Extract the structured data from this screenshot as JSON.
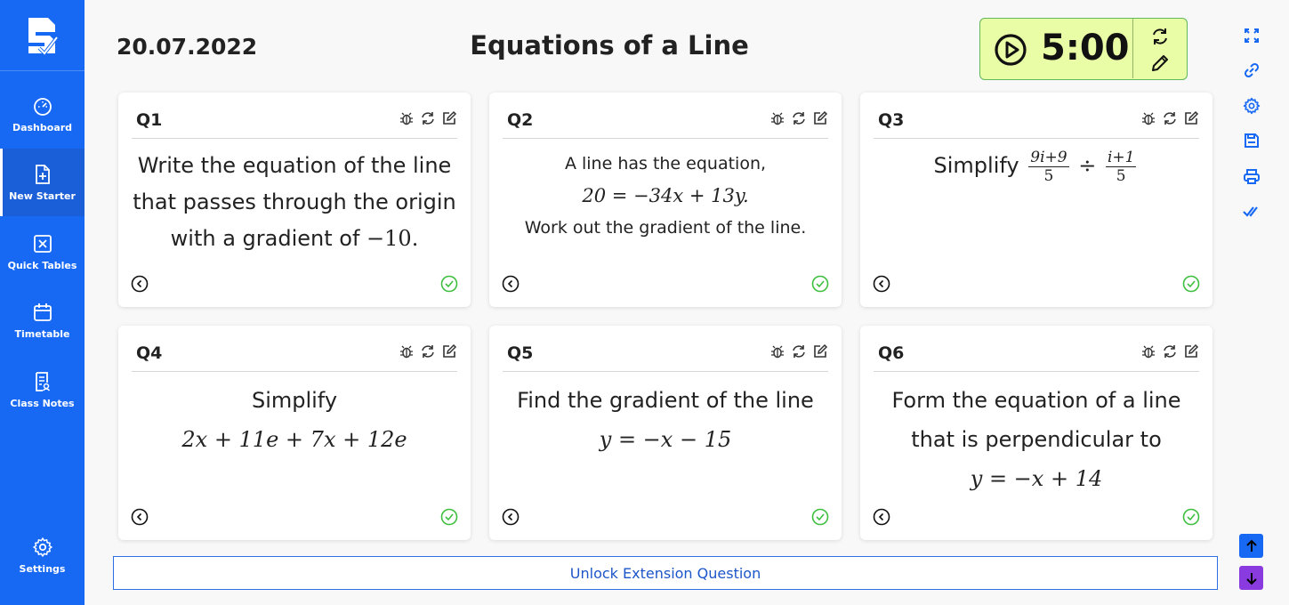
{
  "sidebar": {
    "items": [
      {
        "label": "Dashboard",
        "icon": "gauge-icon"
      },
      {
        "label": "New Starter",
        "icon": "file-plus-icon"
      },
      {
        "label": "Quick Tables",
        "icon": "times-box-icon"
      },
      {
        "label": "Timetable",
        "icon": "calendar-icon"
      },
      {
        "label": "Class Notes",
        "icon": "notes-icon"
      }
    ],
    "settings_label": "Settings"
  },
  "header": {
    "date": "20.07.2022",
    "title": "Equations of a Line"
  },
  "timer": {
    "value": "5:00"
  },
  "cards": [
    {
      "q": "Q1",
      "lines": [
        "Write the equation of the line",
        "that passes through the origin",
        "with a gradient of"
      ],
      "math": "−10."
    },
    {
      "q": "Q2",
      "line1": "A line has the equation,",
      "math": "20 = −34x + 13y.",
      "line2": "Work out the gradient of the line."
    },
    {
      "q": "Q3",
      "text": "Simplify",
      "frac1_num": "9i+9",
      "frac1_den": "5",
      "op": "÷",
      "frac2_num": "i+1",
      "frac2_den": "5"
    },
    {
      "q": "Q4",
      "text": "Simplify",
      "math": "2x + 11e + 7x + 12e"
    },
    {
      "q": "Q5",
      "text": "Find the gradient of the line",
      "math": "y = −x − 15"
    },
    {
      "q": "Q6",
      "lines": [
        "Form the equation of a line",
        "that is perpendicular to"
      ],
      "math": "y = −x + 14"
    }
  ],
  "unlock_label": "Unlock Extension Question",
  "colors": {
    "sidebar": "#1769f4",
    "timer_bg": "#e9fca6",
    "timer_border": "#5fb85a",
    "check": "#3fbf3f",
    "up_button": "#1769f4",
    "down_button": "#8a3be0"
  }
}
